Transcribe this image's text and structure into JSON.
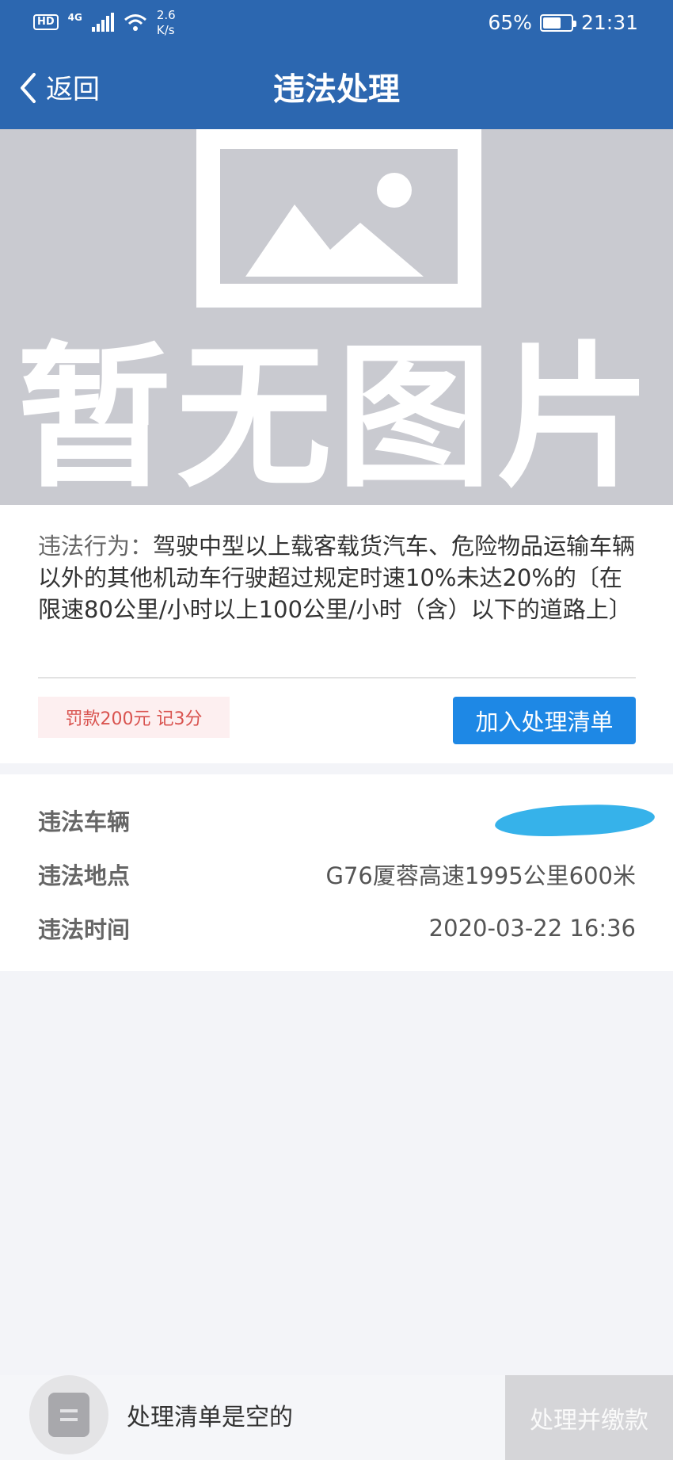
{
  "status_bar": {
    "hd": "HD",
    "network": "4G",
    "speed_value": "2.6",
    "speed_unit": "K/s",
    "battery": "65%",
    "battery_level": 0.65,
    "time": "21:31"
  },
  "nav": {
    "back_label": "返回",
    "title": "违法处理"
  },
  "placeholder": {
    "text": "暂无图片"
  },
  "violation": {
    "behavior_label": "违法行为：",
    "behavior_text": "驾驶中型以上载客载货汽车、危险物品运输车辆以外的其他机动车行驶超过规定时速10%未达20%的〔在限速80公里/小时以上100公里/小时（含）以下的道路上〕",
    "penalty": "罚款200元 记3分",
    "add_button": "加入处理清单"
  },
  "details": {
    "vehicle_label": "违法车辆",
    "location_label": "违法地点",
    "location_value": "G76厦蓉高速1995公里600米",
    "time_label": "违法时间",
    "time_value": "2020-03-22 16:36"
  },
  "bottom": {
    "cart_empty": "处理清单是空的",
    "pay_button": "处理并缴款"
  },
  "colors": {
    "header": "#2c67b0",
    "primary_button": "#1e88e5",
    "penalty_text": "#d9534f",
    "penalty_bg": "#fdeff0",
    "placeholder_bg": "#c9cad0",
    "redaction": "#36b2ea",
    "disabled_button": "#d5d5d8"
  }
}
